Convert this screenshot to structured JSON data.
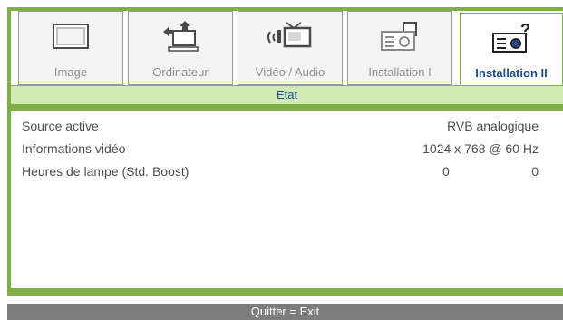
{
  "tabs": [
    {
      "label": "Image",
      "icon": "image-icon"
    },
    {
      "label": "Ordinateur",
      "icon": "computer-icon"
    },
    {
      "label": "Vidéo / Audio",
      "icon": "video-audio-icon"
    },
    {
      "label": "Installation I",
      "icon": "projector-icon"
    },
    {
      "label": "Installation II",
      "icon": "projector-help-icon"
    }
  ],
  "active_tab": "Installation II",
  "section_title": "Etat",
  "rows": [
    {
      "label": "Source active",
      "value": "RVB analogique"
    },
    {
      "label": "Informations vidéo",
      "value": "1024 x 768  @ 60 Hz"
    },
    {
      "label": "Heures de lampe (Std. Boost)",
      "value1": "0",
      "value2": "0"
    }
  ],
  "footer": "Quitter = Exit",
  "colors": {
    "frame_green": "#7fb046",
    "header_green": "#d3e9b6",
    "active_text": "#1e4b8c",
    "footer_gray": "#7d7d7d"
  }
}
